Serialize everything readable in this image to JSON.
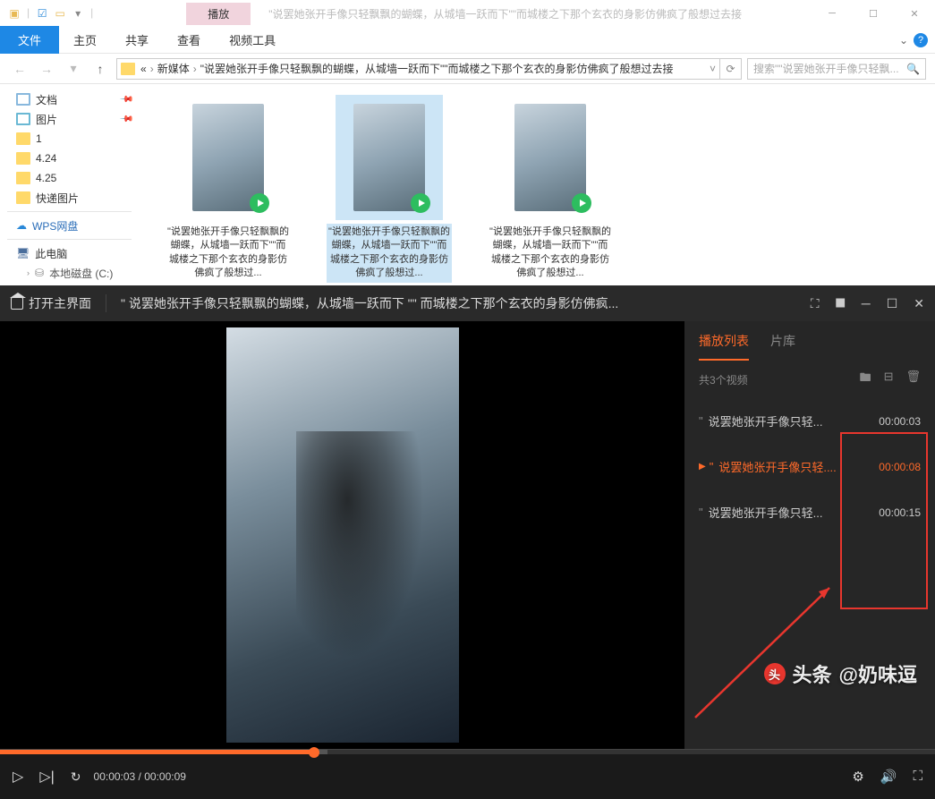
{
  "explorer": {
    "tab_play": "播放",
    "title": "\"说罢她张开手像只轻飘飘的蝴蝶，从城墙一跃而下\"\"而城楼之下那个玄衣的身影仿佛疯了般想过去接",
    "ribbon": {
      "file": "文件",
      "home": "主页",
      "share": "共享",
      "view": "查看",
      "video": "视频工具"
    },
    "breadcrumb": {
      "p1": "新媒体",
      "p2": "\"说罢她张开手像只轻飘飘的蝴蝶，从城墙一跃而下\"\"而城楼之下那个玄衣的身影仿佛疯了般想过去接"
    },
    "search_placeholder": "搜索\"\"说罢她张开手像只轻飘...",
    "tree": {
      "docs": "文档",
      "pics": "图片",
      "f1": "1",
      "f424": "4.24",
      "f425": "4.25",
      "express": "快递图片",
      "wps": "WPS网盘",
      "pc": "此电脑",
      "cdisk": "本地磁盘 (C:)"
    },
    "thumb_caption": "\"说罢她张开手像只轻飘飘的蝴蝶，从城墙一跃而下\"\"而城楼之下那个玄衣的身影仿佛疯了般想过..."
  },
  "player": {
    "open_main": "打开主界面",
    "title": "\" 说罢她张开手像只轻飘飘的蝴蝶，从城墙一跃而下 \"\" 而城楼之下那个玄衣的身影仿佛疯...",
    "tabs": {
      "playlist": "播放列表",
      "library": "片库"
    },
    "count_text": "共3个视频",
    "items": [
      {
        "name": "说罢她张开手像只轻...",
        "dur": "00:00:03"
      },
      {
        "name": "说罢她张开手像只轻....",
        "dur": "00:00:08"
      },
      {
        "name": "说罢她张开手像只轻...",
        "dur": "00:00:15"
      }
    ],
    "time": "00:00:03 / 00:00:09"
  },
  "watermark": {
    "prefix": "头条",
    "author": "@奶味逗"
  }
}
